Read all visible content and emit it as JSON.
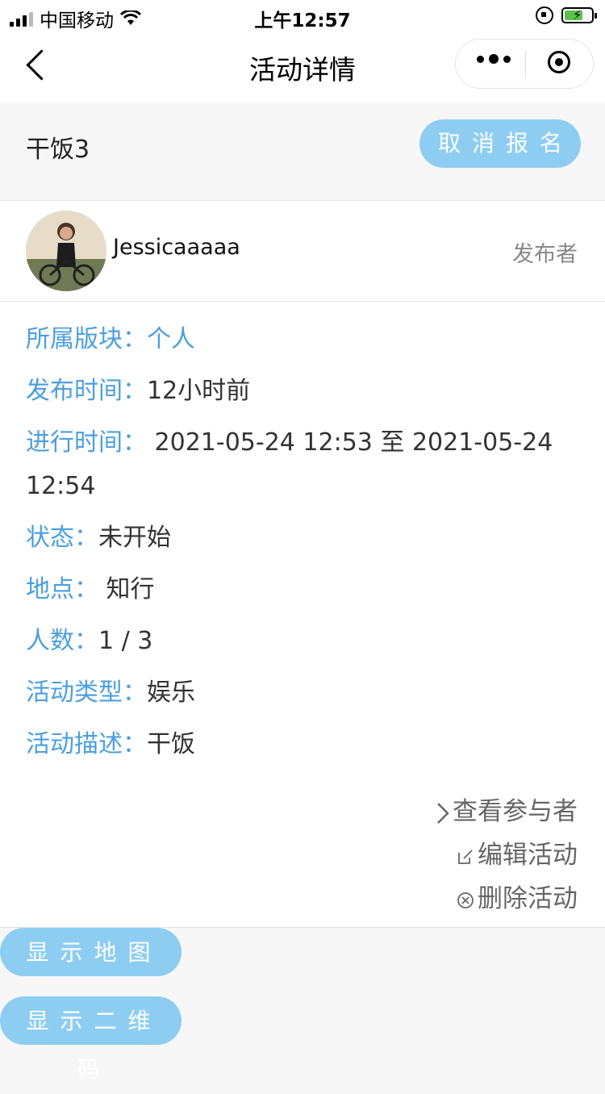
{
  "status_bar": {
    "carrier": "中国移动",
    "time": "上午12:57",
    "battery_charging": true
  },
  "nav": {
    "title": "活动详情"
  },
  "activity": {
    "name": "干饭3",
    "cancel_label": "取消报名"
  },
  "publisher": {
    "username": "Jessicaaaaa",
    "tag": "发布者"
  },
  "details": [
    {
      "label": "所属版块：",
      "value": "个人",
      "value_color": "blue"
    },
    {
      "label": "发布时间：",
      "value": "12小时前"
    },
    {
      "label": "进行时间：",
      "value": " 2021-05-24 12:53 至 2021-05-24 12:54"
    },
    {
      "label": "状态：",
      "value": "未开始"
    },
    {
      "label": "地点：",
      "value": " 知行"
    },
    {
      "label": "人数：",
      "value": "1 / 3"
    },
    {
      "label": "活动类型：",
      "value": "娱乐"
    },
    {
      "label": "活动描述：",
      "value": "干饭"
    }
  ],
  "actions": {
    "view_participants": "查看参与者",
    "edit": "编辑活动",
    "delete": "删除活动"
  },
  "buttons": {
    "show_map": "显示地图",
    "show_qr": "显示二维码"
  },
  "colors": {
    "accent_blue": "#4a9fe0",
    "button_blue": "#8ecdf2"
  }
}
